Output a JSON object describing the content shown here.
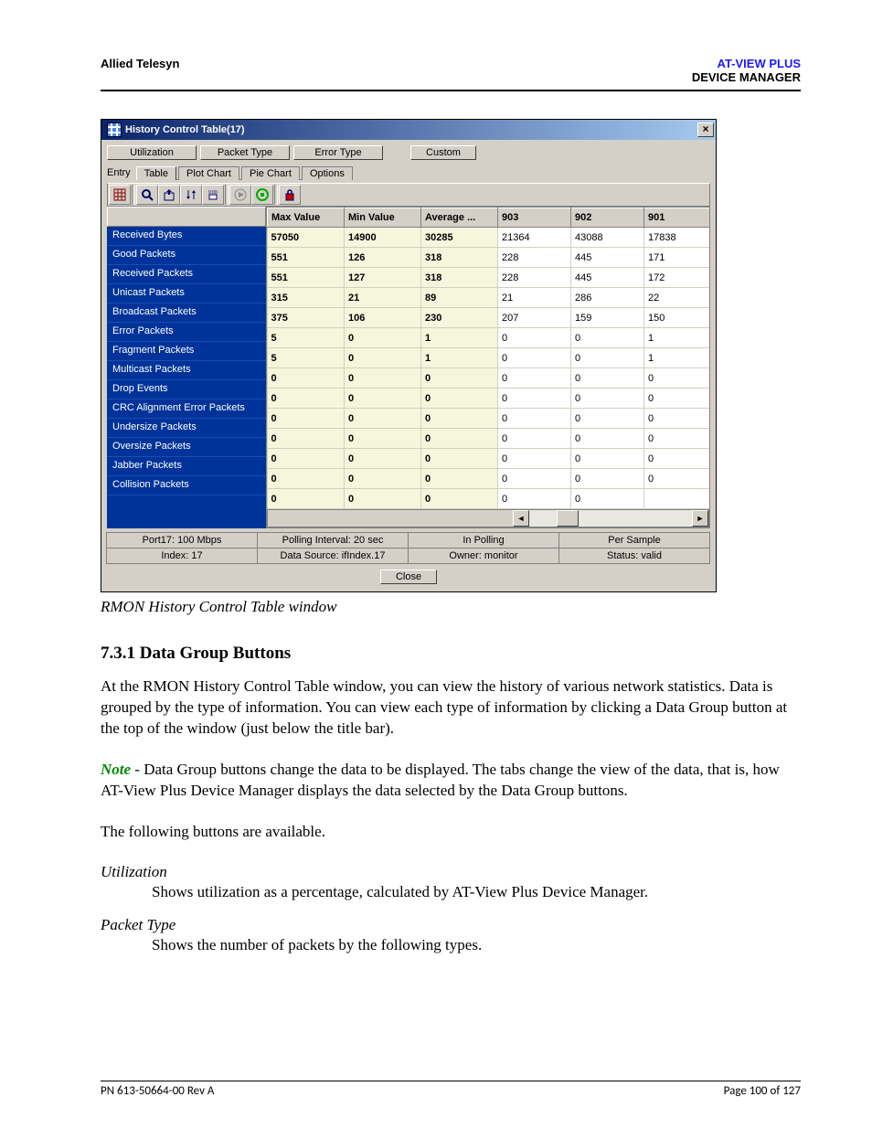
{
  "header": {
    "left": "Allied Telesyn",
    "right_top": "AT-VIEW PLUS",
    "right_bottom": "DEVICE MANAGER"
  },
  "dialog": {
    "title": "History Control Table(17)",
    "close_glyph": "×",
    "group_buttons": {
      "utilization": "Utilization",
      "packet_type": "Packet Type",
      "error_type": "Error Type",
      "custom": "Custom"
    },
    "entry_label": "Entry",
    "tabs": {
      "table": "Table",
      "plot": "Plot Chart",
      "pie": "Pie Chart",
      "options": "Options"
    },
    "table": {
      "columns_fixed": [
        "Max Value",
        "Min Value",
        "Average ..."
      ],
      "columns_dyn": [
        "903",
        "902",
        "901"
      ],
      "rows": [
        {
          "label": "Received Bytes",
          "max": "57050",
          "min": "14900",
          "avg": "30285",
          "d": [
            "21364",
            "43088",
            "17838"
          ]
        },
        {
          "label": "Good Packets",
          "max": "551",
          "min": "126",
          "avg": "318",
          "d": [
            "228",
            "445",
            "171"
          ]
        },
        {
          "label": "Received Packets",
          "max": "551",
          "min": "127",
          "avg": "318",
          "d": [
            "228",
            "445",
            "172"
          ]
        },
        {
          "label": "Unicast Packets",
          "max": "315",
          "min": "21",
          "avg": "89",
          "d": [
            "21",
            "286",
            "22"
          ]
        },
        {
          "label": "Broadcast Packets",
          "max": "375",
          "min": "106",
          "avg": "230",
          "d": [
            "207",
            "159",
            "150"
          ]
        },
        {
          "label": "Error Packets",
          "max": "5",
          "min": "0",
          "avg": "1",
          "d": [
            "0",
            "0",
            "1"
          ]
        },
        {
          "label": "Fragment Packets",
          "max": "5",
          "min": "0",
          "avg": "1",
          "d": [
            "0",
            "0",
            "1"
          ]
        },
        {
          "label": "Multicast Packets",
          "max": "0",
          "min": "0",
          "avg": "0",
          "d": [
            "0",
            "0",
            "0"
          ]
        },
        {
          "label": "Drop Events",
          "max": "0",
          "min": "0",
          "avg": "0",
          "d": [
            "0",
            "0",
            "0"
          ]
        },
        {
          "label": "CRC Alignment Error Packets",
          "max": "0",
          "min": "0",
          "avg": "0",
          "d": [
            "0",
            "0",
            "0"
          ]
        },
        {
          "label": "Undersize Packets",
          "max": "0",
          "min": "0",
          "avg": "0",
          "d": [
            "0",
            "0",
            "0"
          ]
        },
        {
          "label": "Oversize Packets",
          "max": "0",
          "min": "0",
          "avg": "0",
          "d": [
            "0",
            "0",
            "0"
          ]
        },
        {
          "label": "Jabber Packets",
          "max": "0",
          "min": "0",
          "avg": "0",
          "d": [
            "0",
            "0",
            "0"
          ]
        },
        {
          "label": "Collision Packets",
          "max": "0",
          "min": "0",
          "avg": "0",
          "d": [
            "0",
            "0",
            ""
          ]
        }
      ]
    },
    "scroll": {
      "left_glyph": "◄",
      "right_glyph": "►"
    },
    "status": [
      [
        "Port17: 100 Mbps",
        "Polling Interval: 20 sec",
        "In Polling",
        "Per Sample"
      ],
      [
        "Index: 17",
        "Data Source: ifIndex.17",
        "Owner: monitor",
        "Status: valid"
      ]
    ],
    "close_button": "Close"
  },
  "caption": "RMON History Control Table window",
  "section_heading": "7.3.1 Data Group Buttons",
  "para1": "At the RMON History Control Table window, you can view the history of various network statistics. Data is grouped by the type of information. You can view each type of information by clicking a Data Group button at the top of the window (just below the title bar).",
  "note_label": "Note",
  "note_body": " - Data Group buttons change the data to be displayed. The tabs change the view of the data, that is, how AT-View Plus Device Manager displays the data selected by the Data Group buttons.",
  "para3": "The following buttons are available.",
  "defs": {
    "utilization_term": "Utilization",
    "utilization_def": "Shows utilization as a percentage, calculated by AT-View Plus Device Manager.",
    "packet_type_term": "Packet Type",
    "packet_type_def": "Shows the number of packets by the following types."
  },
  "footer": {
    "left": "PN 613-50664-00 Rev A",
    "right": "Page 100 of 127"
  }
}
